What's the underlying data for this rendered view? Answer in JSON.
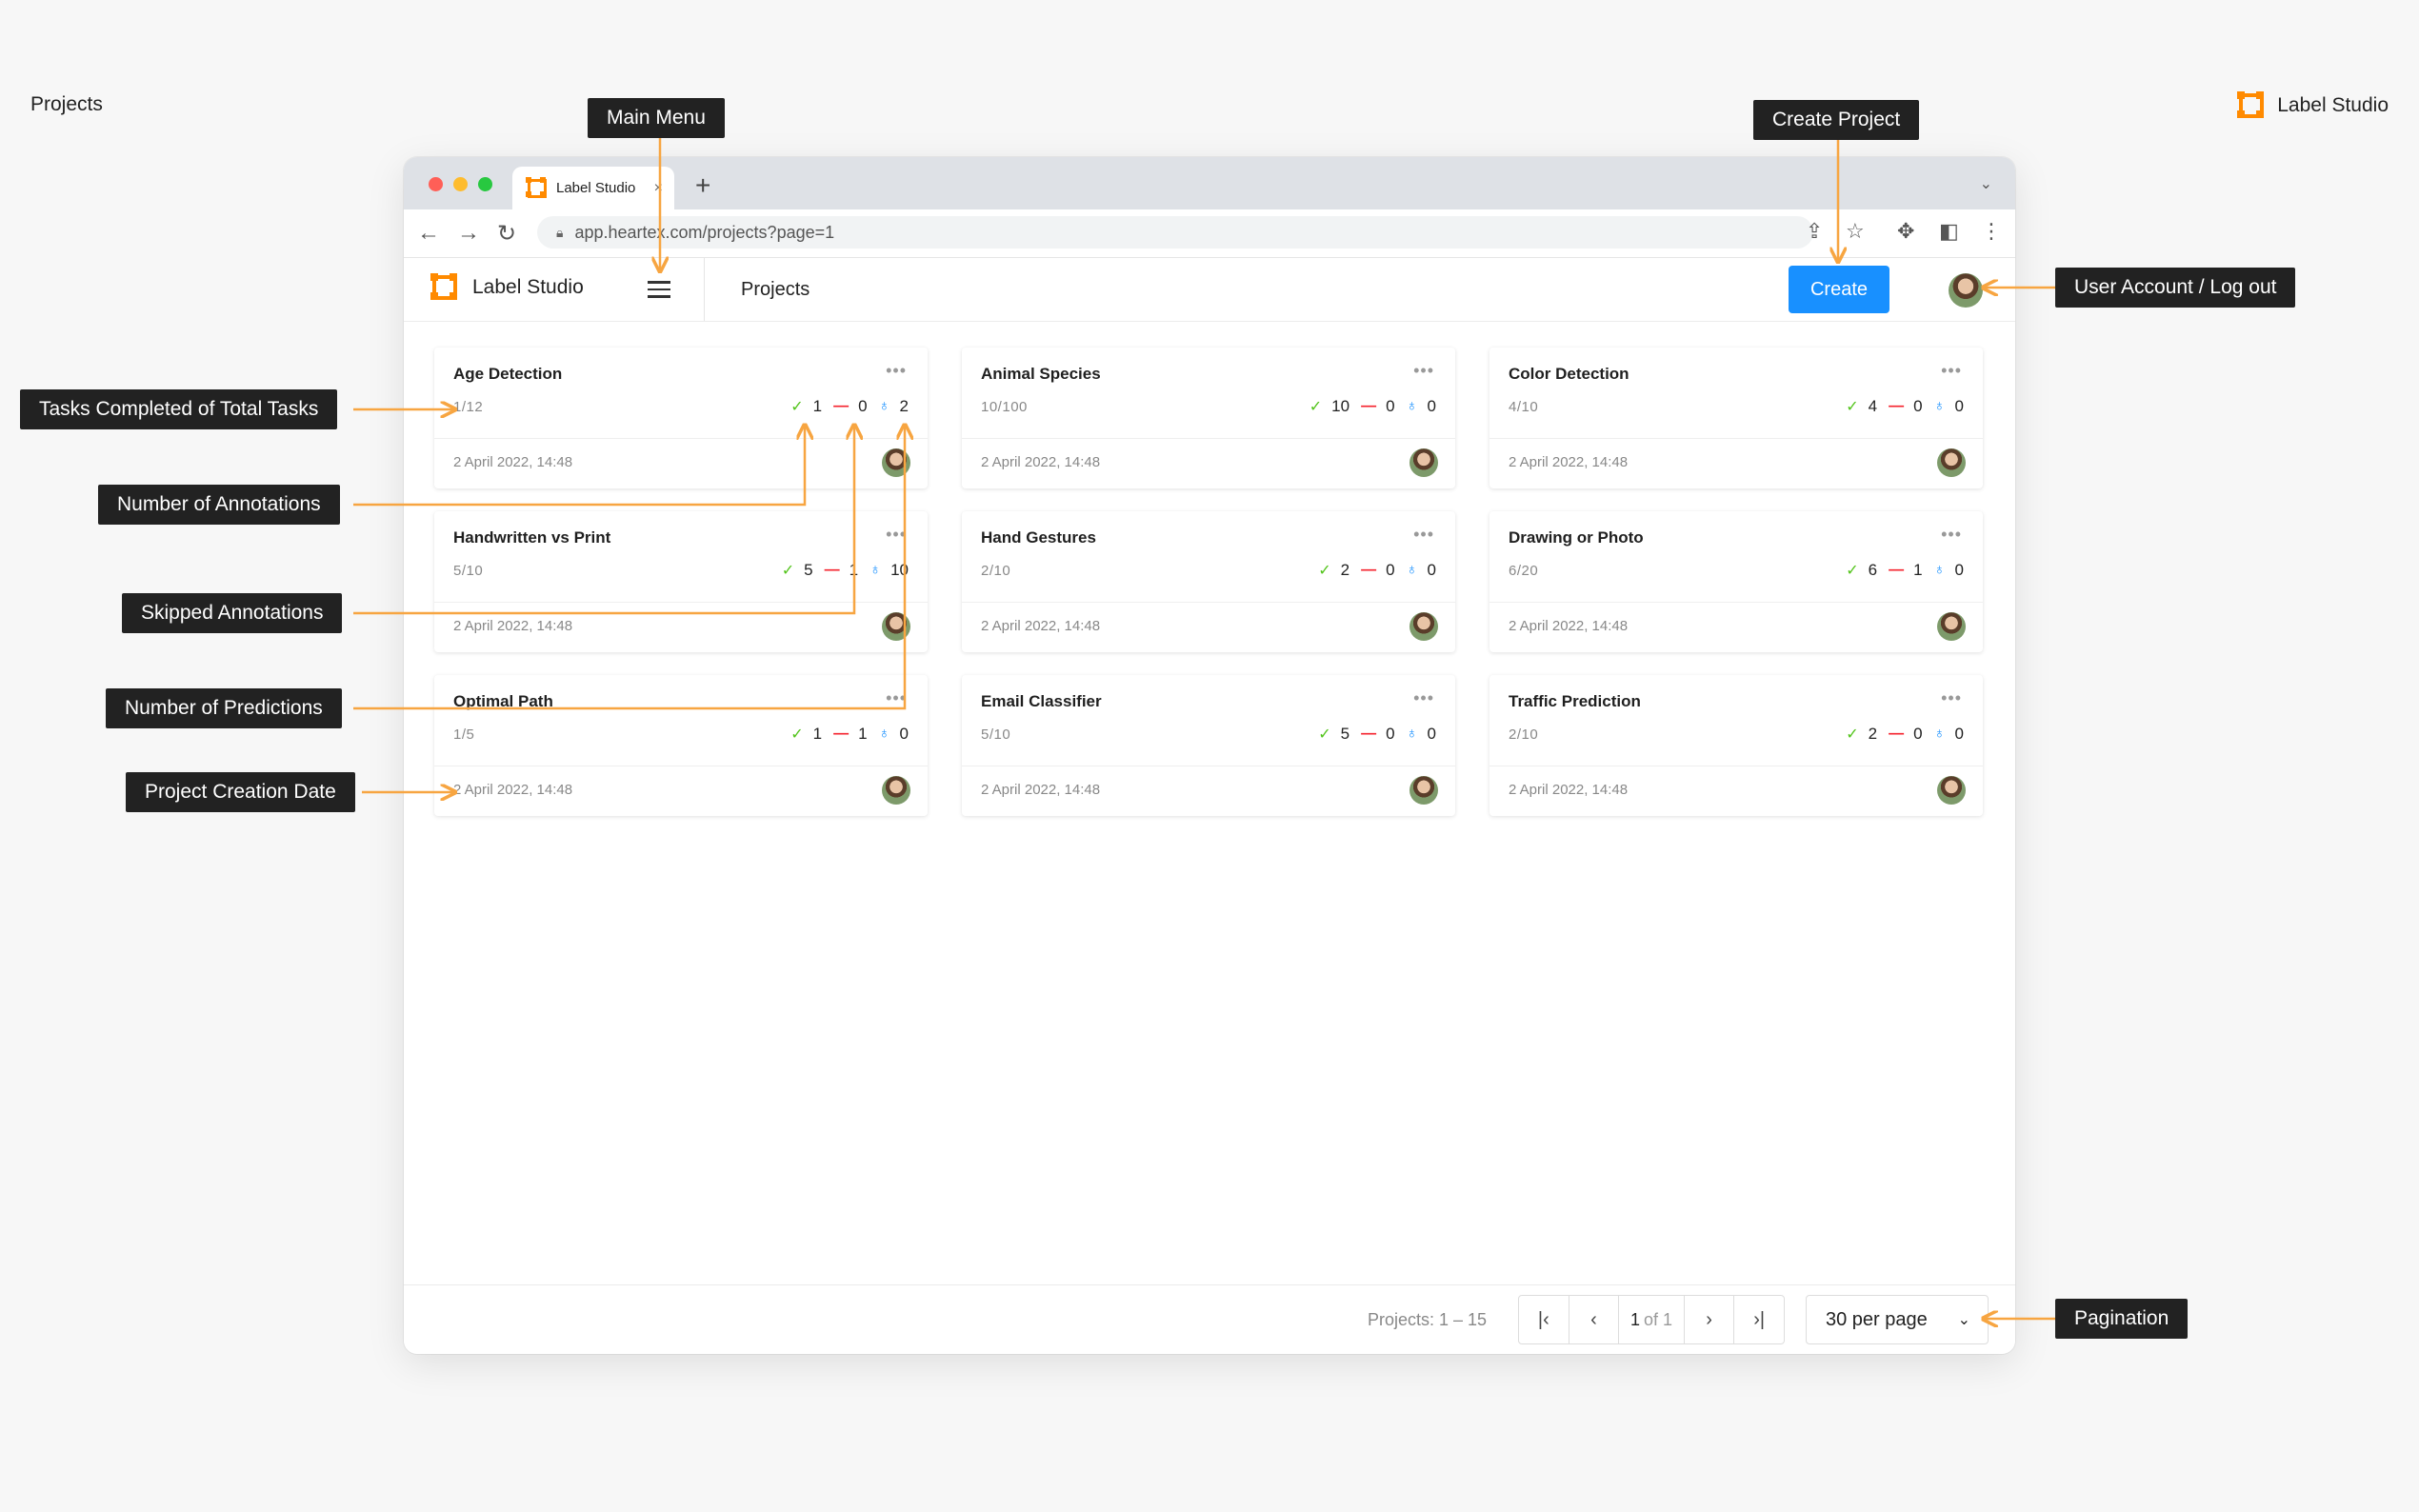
{
  "page": {
    "caption": "Projects",
    "brand_corner": "Label Studio"
  },
  "browser": {
    "tab_title": "Label Studio",
    "tab_close": "×",
    "new_tab": "+",
    "url": "app.heartex.com/projects?page=1"
  },
  "app": {
    "brand": "Label Studio",
    "section_title": "Projects",
    "create_label": "Create"
  },
  "projects": [
    {
      "title": "Age Detection",
      "progress": "1/12",
      "completed": "1",
      "skipped": "0",
      "predictions": "2",
      "date": "2 April 2022, 14:48"
    },
    {
      "title": "Animal Species",
      "progress": "10/100",
      "completed": "10",
      "skipped": "0",
      "predictions": "0",
      "date": "2 April 2022, 14:48"
    },
    {
      "title": "Color Detection",
      "progress": "4/10",
      "completed": "4",
      "skipped": "0",
      "predictions": "0",
      "date": "2 April 2022, 14:48"
    },
    {
      "title": "Handwritten vs Print",
      "progress": "5/10",
      "completed": "5",
      "skipped": "1",
      "predictions": "10",
      "date": "2 April 2022, 14:48"
    },
    {
      "title": "Hand Gestures",
      "progress": "2/10",
      "completed": "2",
      "skipped": "0",
      "predictions": "0",
      "date": "2 April 2022, 14:48"
    },
    {
      "title": "Drawing or Photo",
      "progress": "6/20",
      "completed": "6",
      "skipped": "1",
      "predictions": "0",
      "date": "2 April 2022, 14:48"
    },
    {
      "title": "Optimal Path",
      "progress": "1/5",
      "completed": "1",
      "skipped": "1",
      "predictions": "0",
      "date": "2 April 2022, 14:48"
    },
    {
      "title": "Email Classifier",
      "progress": "5/10",
      "completed": "5",
      "skipped": "0",
      "predictions": "0",
      "date": "2 April 2022, 14:48"
    },
    {
      "title": "Traffic Prediction",
      "progress": "2/10",
      "completed": "2",
      "skipped": "0",
      "predictions": "0",
      "date": "2 April 2022, 14:48"
    }
  ],
  "footer": {
    "projects_count": "Projects: 1 – 15",
    "page_current": "1",
    "page_of": "of 1",
    "per_page": "30 per page"
  },
  "callouts": {
    "main_menu": "Main Menu",
    "create_project": "Create Project",
    "user_account": "User Account / Log out",
    "tasks_completed": "Tasks Completed of Total Tasks",
    "num_annotations": "Number of Annotations",
    "skipped_annotations": "Skipped Annotations",
    "num_predictions": "Number of Predictions",
    "creation_date": "Project Creation Date",
    "pagination": "Pagination"
  },
  "colors": {
    "accent": "#1890ff",
    "brand": "#ff8a00",
    "completed": "#52c41a",
    "skipped": "#f5222d",
    "callout_line": "#f7a541"
  }
}
